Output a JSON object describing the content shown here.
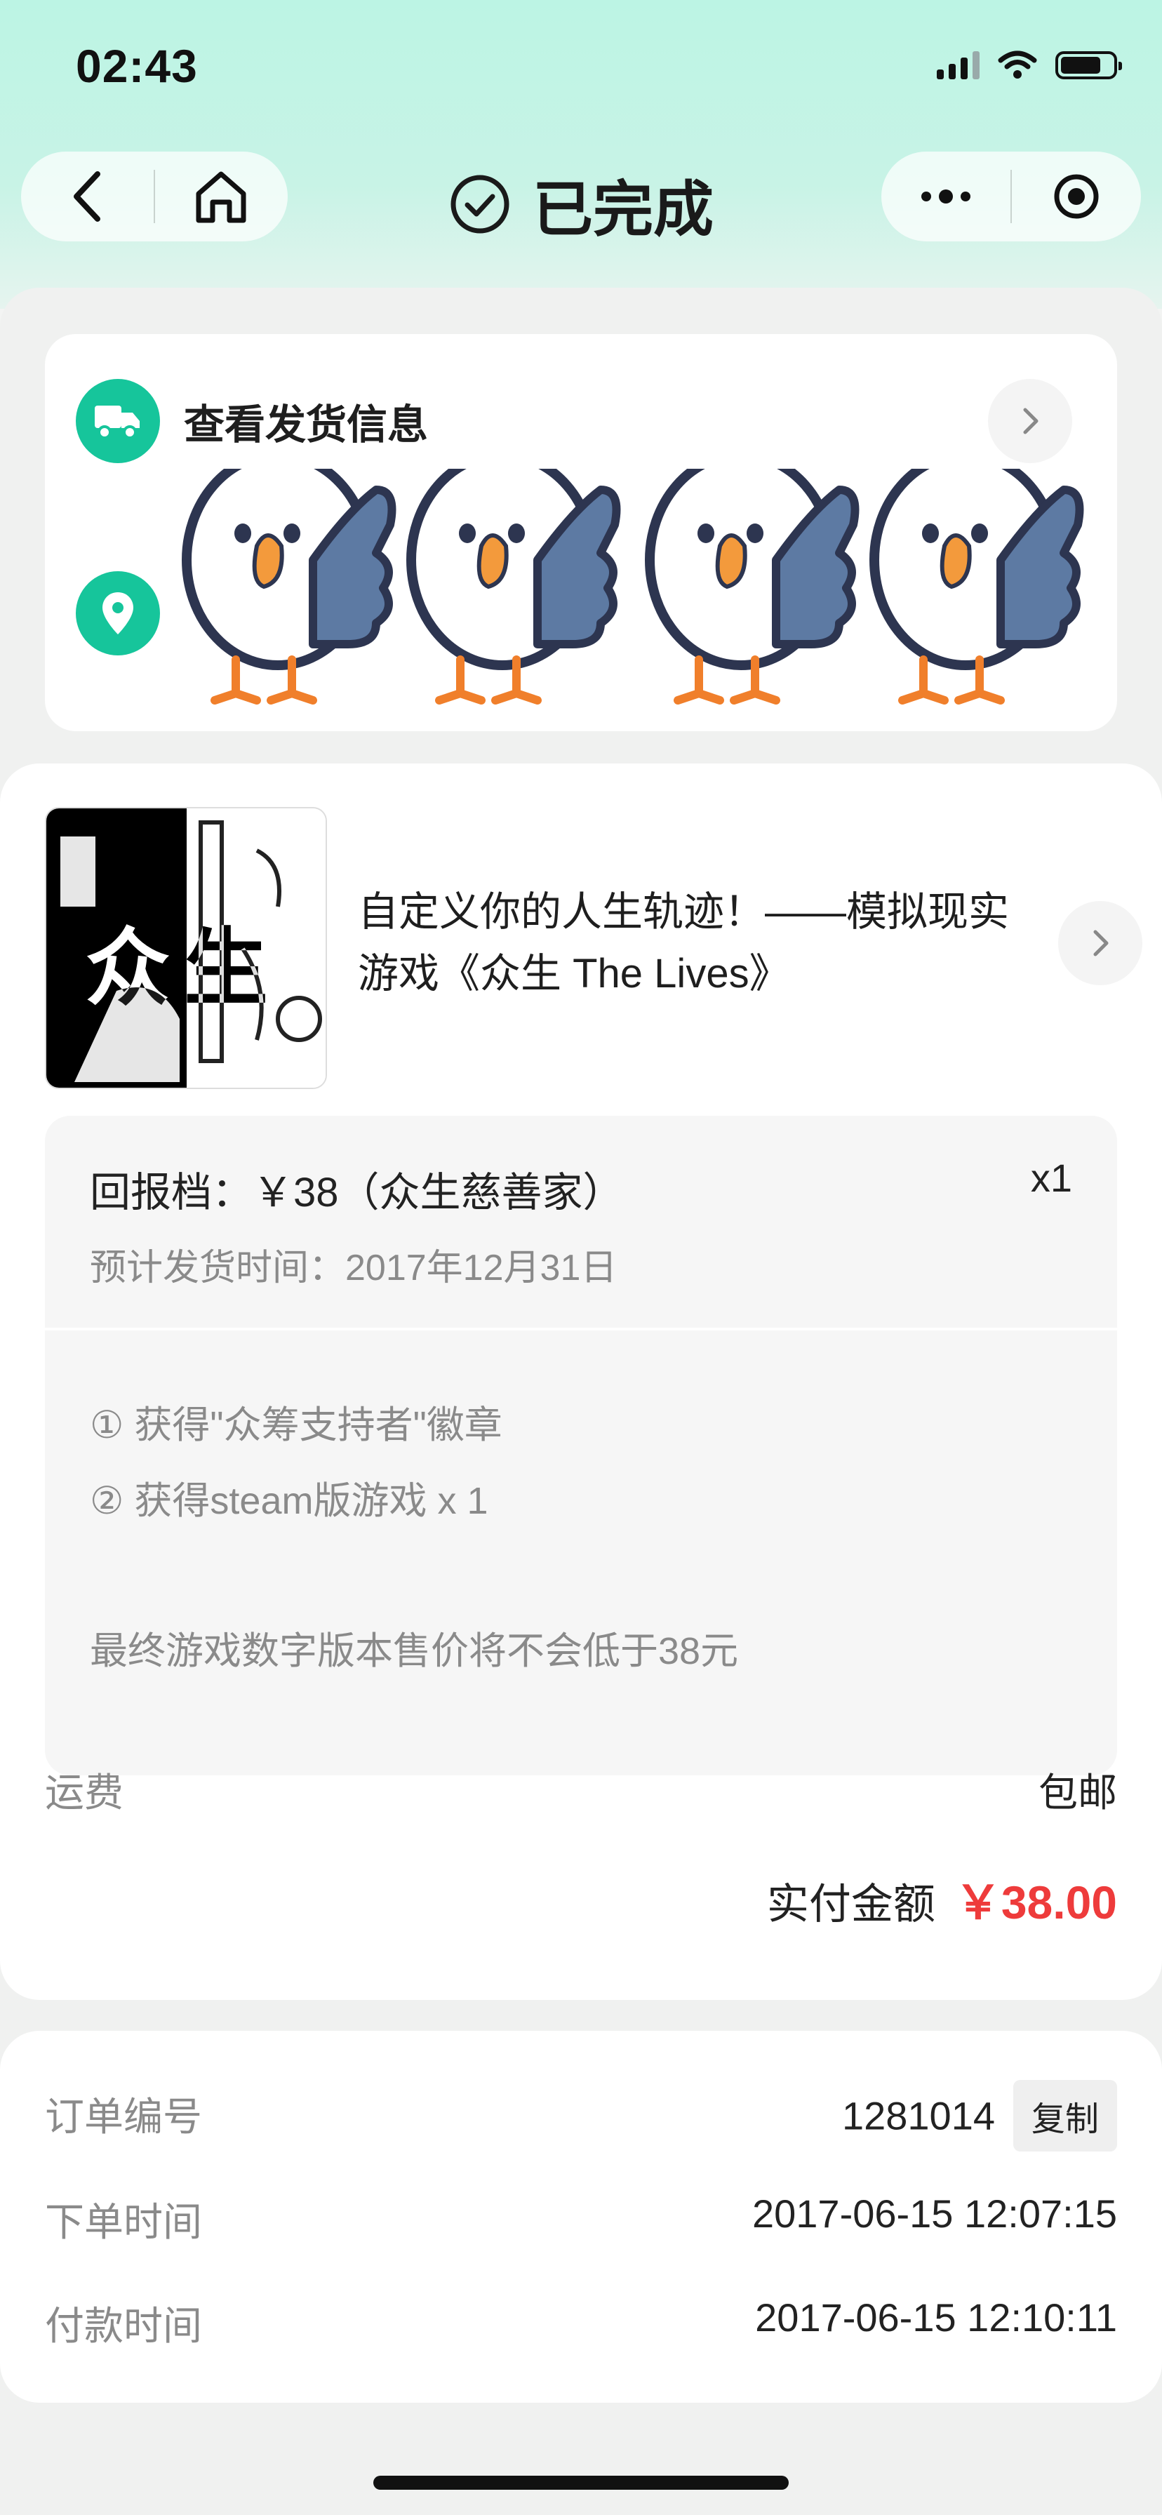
{
  "status_bar": {
    "time": "02:43",
    "battery_level": 0.78
  },
  "nav": {
    "title": "已完成"
  },
  "shipping": {
    "view_label": "查看发货信息"
  },
  "product": {
    "title": "自定义你的人生轨迹！——模拟现实游戏《众生 The Lives》",
    "cover_text": "众生"
  },
  "reward": {
    "tier": "回报档：￥38（众生慈善家）",
    "quantity": "x1",
    "eta": "预计发货时间：2017年12月31日",
    "items": [
      "① 获得\"众筹支持者\"徽章",
      "② 获得steam版游戏 x 1"
    ],
    "note": "最终游戏数字版本售价将不会低于38元"
  },
  "summary": {
    "shipping_label": "运费",
    "shipping_value": "包邮",
    "paid_label": "实付金额",
    "paid_amount": "￥38.00"
  },
  "order": {
    "number_label": "订单编号",
    "number_value": "1281014",
    "copy_label": "复制",
    "created_label": "下单时间",
    "created_value": "2017-06-15 12:07:15",
    "paid_time_label": "付款时间",
    "paid_time_value": "2017-06-15 12:10:11"
  },
  "colors": {
    "accent": "#16c59b",
    "price": "#ee3b3b"
  }
}
